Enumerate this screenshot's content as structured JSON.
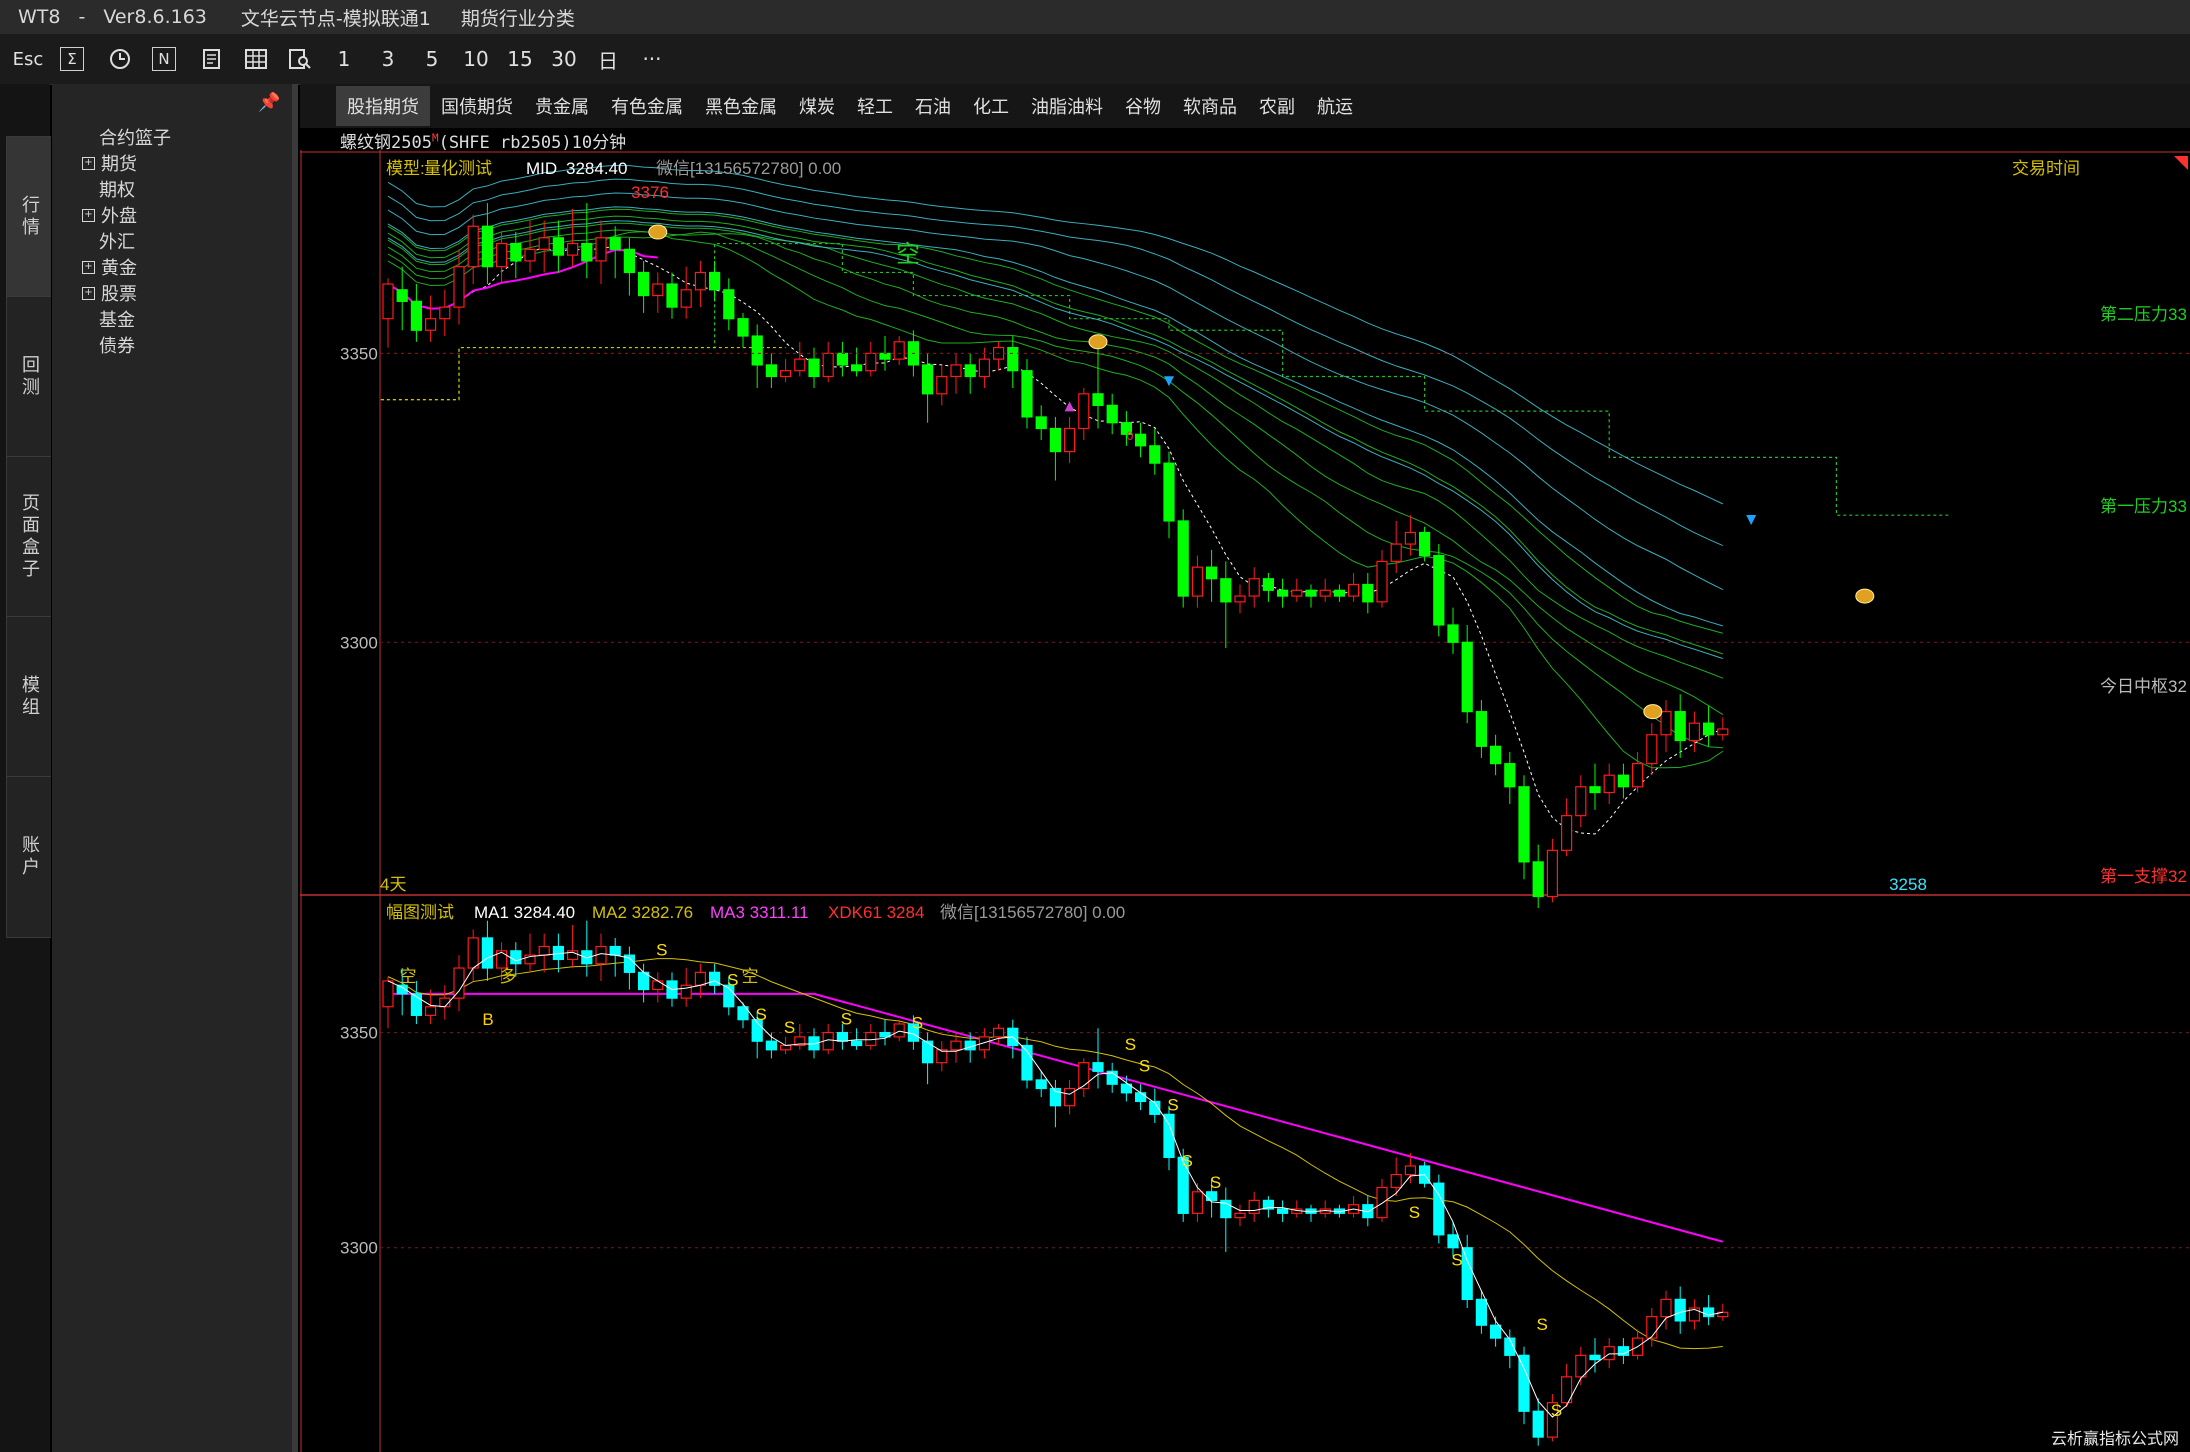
{
  "titlebar": {
    "app": "WT8",
    "dash": "-",
    "version": "Ver8.6.163",
    "server": "文华云节点-模拟联通1",
    "section": "期货行业分类"
  },
  "toolbar": {
    "esc": "Esc",
    "sigma": "Σ",
    "n": "N",
    "i1": "1",
    "i3": "3",
    "i5": "5",
    "i10": "10",
    "i15": "15",
    "i30": "30",
    "day": "日",
    "more": "···"
  },
  "left_tabs": [
    "行情",
    "回测",
    "页面盒子",
    "模组",
    "账户"
  ],
  "tree": {
    "pin": "📌",
    "items": [
      {
        "label": "合约篮子",
        "expandable": false
      },
      {
        "label": "期货",
        "expandable": true
      },
      {
        "label": "期权",
        "expandable": false
      },
      {
        "label": "外盘",
        "expandable": true
      },
      {
        "label": "外汇",
        "expandable": false
      },
      {
        "label": "黄金",
        "expandable": true
      },
      {
        "label": "股票",
        "expandable": true
      },
      {
        "label": "基金",
        "expandable": false
      },
      {
        "label": "债券",
        "expandable": false
      }
    ]
  },
  "categories": [
    "股指期货",
    "国债期货",
    "贵金属",
    "有色金属",
    "黑色金属",
    "煤炭",
    "轻工",
    "石油",
    "化工",
    "油脂油料",
    "谷物",
    "软商品",
    "农副",
    "航运"
  ],
  "contract": {
    "name": "螺纹钢2505",
    "sup": "M",
    "detail": "(SHFE rb2505)10分钟"
  },
  "chart_data": {
    "type": "candlestick",
    "colors": {
      "up": "#ff1a1a",
      "down_top": "#00ff00",
      "down_bottom": "#00ffff",
      "ma_white": "#ffffff",
      "ma_yellow": "#d4c000",
      "ma_magenta": "#ff00ff",
      "bands_green": "#22c022",
      "bands_cyan": "#40c0d0"
    },
    "top_panel": {
      "legend": {
        "model_label": "模型:",
        "model_name": "量化测试",
        "mid_label": "MID",
        "mid_value": "3284.40",
        "wechat": "微信[13156572780] 0.00"
      },
      "right_labels": {
        "trade_time": "交易时间",
        "pressure2": "第二压力33",
        "pressure1": "第一压力33",
        "today_mid": "今日中枢32",
        "support1": "第一支撑32"
      },
      "high_label": "3376",
      "low_label": "3258",
      "span_label": "4天",
      "short_label": "空",
      "o_label": "0",
      "ylim": [
        3258,
        3380
      ],
      "yticks": [
        3350,
        3300
      ],
      "pressure2_level": 3350,
      "pressure1_level": 3316,
      "support1_level": 3255
    },
    "bottom_panel": {
      "legend": {
        "name": "幅图测试",
        "ma1": "MA1 3284.40",
        "ma2": "MA2 3282.76",
        "ma3": "MA3 3311.11",
        "xdk": "XDK61 3284",
        "wechat": "微信[13156572780] 0.00"
      },
      "ylim": [
        3253,
        3375
      ],
      "yticks": [
        3350,
        3300
      ],
      "signals": {
        "kong": "空",
        "duo": "多",
        "b": "B",
        "s": "S"
      }
    },
    "candles": [
      [
        3356,
        3362,
        3351,
        3363
      ],
      [
        3361,
        3359,
        3354,
        3365
      ],
      [
        3359,
        3354,
        3352,
        3362
      ],
      [
        3354,
        3356,
        3352,
        3360
      ],
      [
        3356,
        3358,
        3353,
        3361
      ],
      [
        3358,
        3365,
        3355,
        3368
      ],
      [
        3365,
        3372,
        3362,
        3374
      ],
      [
        3372,
        3365,
        3362,
        3376
      ],
      [
        3365,
        3369,
        3362,
        3371
      ],
      [
        3369,
        3366,
        3363,
        3371
      ],
      [
        3366,
        3368,
        3364,
        3373
      ],
      [
        3368,
        3370,
        3364,
        3373
      ],
      [
        3370,
        3367,
        3364,
        3373
      ],
      [
        3367,
        3369,
        3365,
        3375
      ],
      [
        3369,
        3366,
        3363,
        3376
      ],
      [
        3366,
        3370,
        3362,
        3373
      ],
      [
        3370,
        3368,
        3363,
        3372
      ],
      [
        3368,
        3364,
        3360,
        3370
      ],
      [
        3364,
        3360,
        3357,
        3366
      ],
      [
        3360,
        3362,
        3357,
        3364
      ],
      [
        3362,
        3358,
        3356,
        3364
      ],
      [
        3358,
        3361,
        3356,
        3365
      ],
      [
        3361,
        3364,
        3358,
        3366
      ],
      [
        3364,
        3361,
        3359,
        3366
      ],
      [
        3361,
        3356,
        3354,
        3363
      ],
      [
        3356,
        3353,
        3351,
        3357
      ],
      [
        3353,
        3348,
        3344,
        3355
      ],
      [
        3348,
        3346,
        3344,
        3350
      ],
      [
        3346,
        3347,
        3345,
        3349
      ],
      [
        3347,
        3349,
        3346,
        3352
      ],
      [
        3349,
        3346,
        3344,
        3351
      ],
      [
        3346,
        3350,
        3345,
        3352
      ],
      [
        3350,
        3348,
        3346,
        3352
      ],
      [
        3348,
        3347,
        3346,
        3351
      ],
      [
        3347,
        3350,
        3346,
        3352
      ],
      [
        3350,
        3349,
        3347,
        3353
      ],
      [
        3349,
        3352,
        3348,
        3353
      ],
      [
        3352,
        3348,
        3346,
        3354
      ],
      [
        3348,
        3343,
        3338,
        3350
      ],
      [
        3343,
        3346,
        3341,
        3348
      ],
      [
        3346,
        3348,
        3343,
        3350
      ],
      [
        3348,
        3346,
        3343,
        3350
      ],
      [
        3346,
        3349,
        3344,
        3351
      ],
      [
        3349,
        3351,
        3347,
        3352
      ],
      [
        3351,
        3347,
        3344,
        3353
      ],
      [
        3347,
        3339,
        3337,
        3349
      ],
      [
        3339,
        3337,
        3335,
        3341
      ],
      [
        3337,
        3333,
        3328,
        3339
      ],
      [
        3333,
        3337,
        3331,
        3339
      ],
      [
        3337,
        3343,
        3335,
        3344
      ],
      [
        3343,
        3341,
        3337,
        3351
      ],
      [
        3341,
        3338,
        3336,
        3343
      ],
      [
        3338,
        3336,
        3334,
        3340
      ],
      [
        3336,
        3334,
        3332,
        3338
      ],
      [
        3334,
        3331,
        3329,
        3337
      ],
      [
        3331,
        3321,
        3318,
        3333
      ],
      [
        3321,
        3308,
        3306,
        3323
      ],
      [
        3308,
        3313,
        3306,
        3315
      ],
      [
        3313,
        3311,
        3307,
        3316
      ],
      [
        3311,
        3307,
        3299,
        3314
      ],
      [
        3307,
        3308,
        3305,
        3310
      ],
      [
        3308,
        3311,
        3306,
        3313
      ],
      [
        3311,
        3309,
        3307,
        3312
      ],
      [
        3309,
        3308,
        3306,
        3311
      ],
      [
        3308,
        3309,
        3307,
        3311
      ],
      [
        3309,
        3308,
        3306,
        3310
      ],
      [
        3308,
        3309,
        3307,
        3311
      ],
      [
        3309,
        3308,
        3307,
        3310
      ],
      [
        3308,
        3310,
        3307,
        3312
      ],
      [
        3310,
        3307,
        3305,
        3312
      ],
      [
        3307,
        3314,
        3306,
        3316
      ],
      [
        3314,
        3317,
        3312,
        3321
      ],
      [
        3317,
        3319,
        3315,
        3322
      ],
      [
        3319,
        3315,
        3314,
        3320
      ],
      [
        3315,
        3303,
        3301,
        3317
      ],
      [
        3303,
        3300,
        3298,
        3306
      ],
      [
        3300,
        3288,
        3286,
        3303
      ],
      [
        3288,
        3282,
        3280,
        3290
      ],
      [
        3282,
        3279,
        3277,
        3284
      ],
      [
        3279,
        3275,
        3272,
        3281
      ],
      [
        3275,
        3262,
        3259,
        3277
      ],
      [
        3262,
        3256,
        3254,
        3265
      ],
      [
        3256,
        3264,
        3255,
        3266
      ],
      [
        3264,
        3270,
        3263,
        3273
      ],
      [
        3270,
        3275,
        3268,
        3277
      ],
      [
        3275,
        3274,
        3271,
        3279
      ],
      [
        3274,
        3277,
        3272,
        3279
      ],
      [
        3277,
        3275,
        3273,
        3279
      ],
      [
        3275,
        3279,
        3274,
        3281
      ],
      [
        3279,
        3284,
        3277,
        3286
      ],
      [
        3284,
        3288,
        3281,
        3290
      ],
      [
        3288,
        3283,
        3280,
        3291
      ],
      [
        3283,
        3286,
        3281,
        3288
      ],
      [
        3286,
        3284,
        3282,
        3289
      ],
      [
        3284,
        3285,
        3283,
        3287
      ]
    ]
  },
  "watermark": "云析赢指标公式网"
}
